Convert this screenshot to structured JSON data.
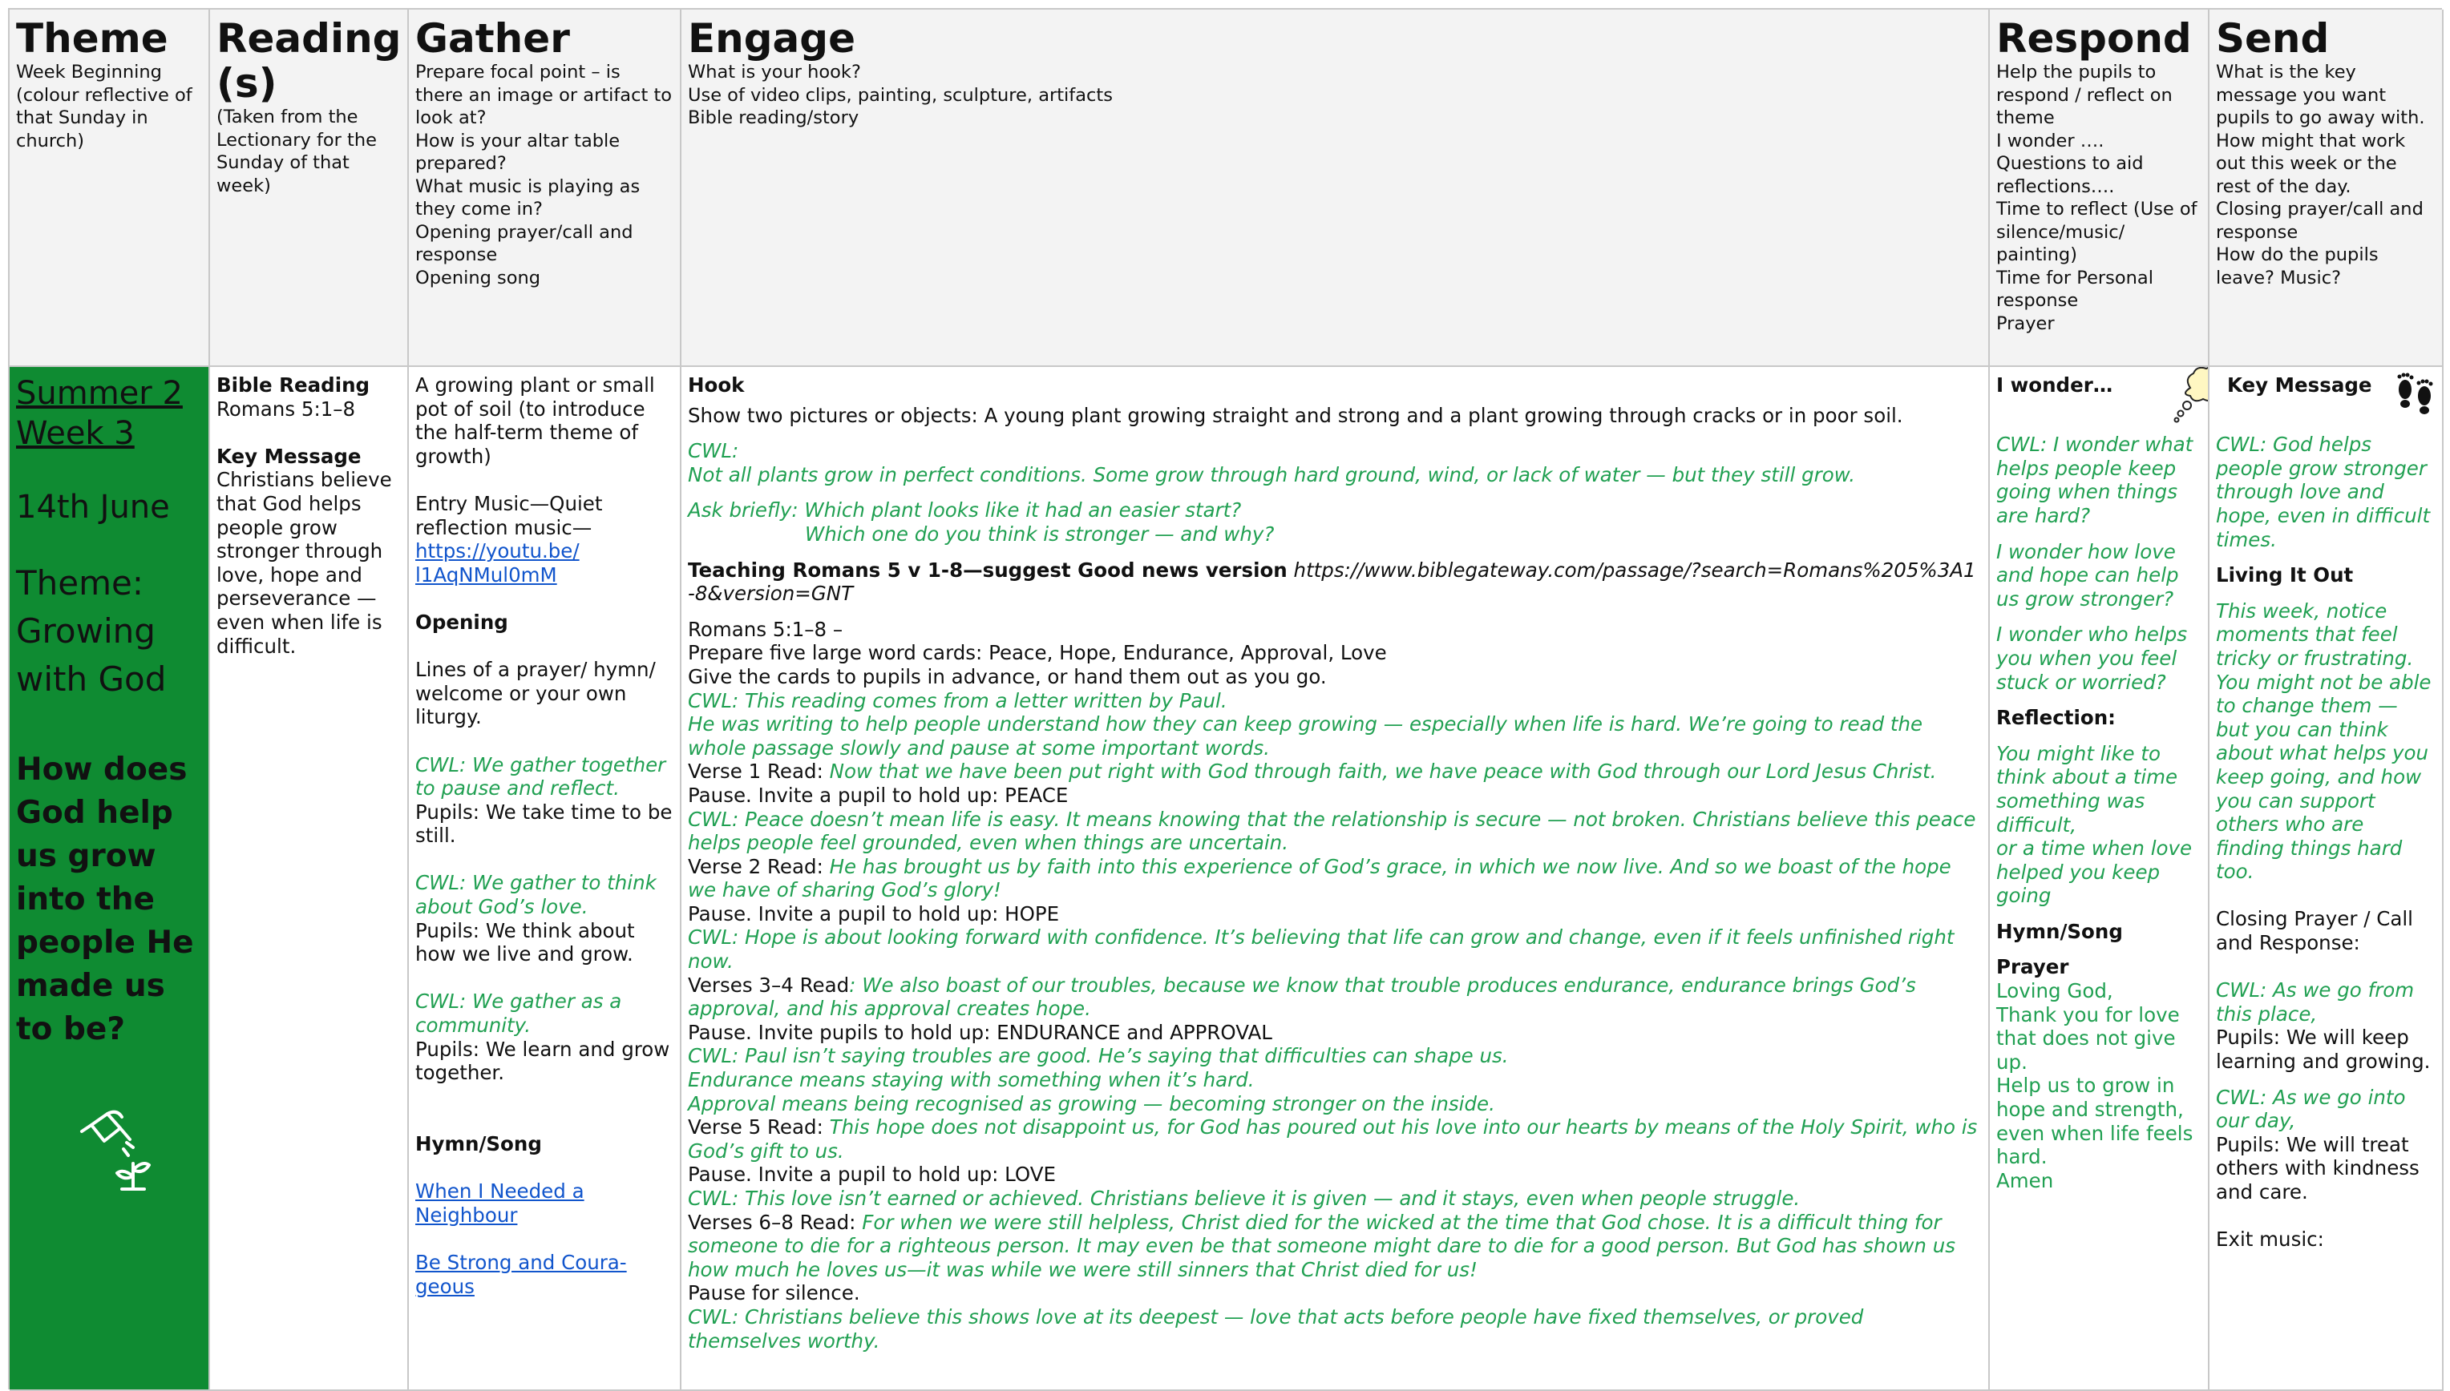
{
  "header": {
    "theme": {
      "title": "Theme",
      "desc": "Week Beginning (colour reflective of that Sunday in church)"
    },
    "reading": {
      "title": "Reading (s)",
      "desc": "(Taken from the Lectionary for the Sunday of that week)"
    },
    "gather": {
      "title": "Gather",
      "desc": "Prepare focal point – is there an image or artifact to look at?\nHow is your altar  table prepared?\nWhat music is playing as they come in?\nOpening prayer/call and response\nOpening song"
    },
    "engage": {
      "title": "Engage",
      "desc": "What is your hook?\nUse of video clips, painting, sculpture, artifacts\nBible reading/story"
    },
    "respond": {
      "title": "Respond",
      "desc": "Help the pupils to respond / reflect on theme\nI wonder ….\nQuestions to aid reflections….\nTime to reflect (Use of silence/music/ painting)\nTime for Personal response\nPrayer"
    },
    "send": {
      "title": "Send",
      "desc": "What is the key message you want pupils to go away with.\nHow might that work out this week or the rest of the day.\nClosing prayer/call and response\nHow do the pupils leave? Music?"
    }
  },
  "theme": {
    "week_line1": "Summer 2",
    "week_line2": "Week 3",
    "date": "14th June",
    "theme_label": "Theme: Growing with God",
    "question": "How does God help us grow into the people He made us to be?",
    "icon": "watering-can-plant-icon"
  },
  "reading": {
    "bible_heading": "Bible Reading",
    "bible_ref": "Romans 5:1–8",
    "key_heading": "Key Message",
    "key_text": "Christians believe that God helps people grow stronger through love, hope and perseverance — even when life is difficult."
  },
  "gather": {
    "intro": "A growing plant or small pot of soil (to introduce the half-term theme of growth)",
    "entry": "Entry Music—Quiet reflection music—",
    "entry_link": "https://youtu.be/ l1AqNMul0mM",
    "opening_heading": "Opening",
    "opening_text": "Lines of a prayer/ hymn/ welcome or your own liturgy.",
    "cwl1": "CWL: We gather together to pause and reflect.",
    "pupils1": "Pupils: We take time to be still.",
    "cwl2": "CWL: We gather to think about God’s love.",
    "pupils2": "Pupils: We think about how we live and grow.",
    "cwl3": "CWL: We gather as a community.",
    "pupils3": "Pupils: We learn and grow together.",
    "hymn_heading": "Hymn/Song",
    "hymn1": "When I Needed a Neighbour",
    "hymn2": "Be Strong and Coura-geous"
  },
  "engage": {
    "hook_heading": "Hook",
    "hook_text": "Show two pictures or objects: A young plant growing straight and strong and a plant growing through cracks or in poor soil.",
    "cwl_label": "CWL:",
    "cwl_plants": "Not all plants grow in perfect conditions. Some grow through hard ground, wind, or lack of water — but they still grow.",
    "ask1": "Ask briefly: Which plant looks like it had an easier start?",
    "ask2": "Which one do you think is stronger — and why?",
    "teaching_bold": "Teaching Romans 5 v 1-8—suggest Good news version",
    "teaching_url": "https://www.biblegateway.com/passage/?search=Romans%205%3A1-8&version=GNT",
    "romans_ref": "Romans 5:1–8 –",
    "cards_line1": "Prepare five large word cards: Peace, Hope, Endurance, Approval, Love",
    "cards_line2": "Give the cards to pupils in advance, or hand them out as you go.",
    "cwl_letter": "CWL: This reading comes from a letter written by Paul.",
    "cwl_writing": "He was writing to help people understand how they can keep growing — especially when life is hard. We’re going to read the whole passage slowly and pause at some important words.",
    "v1_label": "Verse 1 Read:",
    "v1_text": "Now that we have been put right with God through faith, we have peace with God through our Lord Jesus Christ.",
    "pause_peace": "Pause. Invite a pupil to hold up: PEACE",
    "cwl_peace": "CWL: Peace doesn’t mean life is easy. It means knowing that the relationship is secure — not broken. Christians believe this peace helps people feel grounded, even when things are uncertain.",
    "v2_label": "Verse 2 Read:",
    "v2_text": "He has brought us by faith into this experience of God’s grace, in which we now live. And so we boast of the hope we have of sharing God’s glory!",
    "pause_hope": "Pause. Invite a pupil to hold up: HOPE",
    "cwl_hope": "CWL: Hope is about looking forward with confidence. It’s believing that life can grow and change, even if it feels unfinished right now.",
    "v34_label": "Verses 3–4 Read",
    "v34_text": ": We also boast of our troubles, because we know that trouble produces endurance, endurance brings God’s approval, and his approval creates hope.",
    "pause_endurance": "Pause. Invite pupils to hold up: ENDURANCE and APPROVAL",
    "cwl_troubles": "CWL: Paul isn’t saying troubles are good. He’s saying that difficulties can shape us.",
    "endurance_means": "Endurance means staying with something when it’s hard.",
    "approval_means": "Approval means being recognised as growing — becoming stronger on the inside.",
    "v5_label": "Verse 5 Read:",
    "v5_text": "This hope does not disappoint us, for God has poured out his love into our hearts by means of the Holy Spirit, who is God’s gift to us.",
    "pause_love": "Pause. Invite a pupil to hold up: LOVE",
    "cwl_love": "CWL: This love isn’t earned or achieved. Christians believe it is given — and it stays, even when people struggle.",
    "v68_label": "Verses 6–8 Read:",
    "v68_text": "For when we were still helpless, Christ died for the wicked at the time that God chose. It is a difficult thing for someone to die for a righteous person. It may even be that someone might dare to die for a good person. But God has shown us how much he loves us—it was while we were still sinners that Christ died for us!",
    "pause_silence": "Pause for silence.",
    "cwl_deepest": "CWL: Christians believe this shows love at its deepest — love that acts before people have fixed themselves, or proved themselves worthy."
  },
  "respond": {
    "wonder_heading": "I wonder…",
    "thought_icon": "thought-bubble-icon",
    "w1": "CWL: I wonder what helps people keep going when things are hard?",
    "w2": "I wonder how love and hope can help us grow stronger?",
    "w3": "I wonder who helps you when you feel stuck or worried?",
    "reflection_heading": "Reflection:",
    "reflection_text": "You might like to think about a time something was difficult,\nor a time when love helped you keep going",
    "hymn_heading": "Hymn/Song",
    "prayer_heading": "Prayer",
    "prayer_text": "Loving God,\nThank you for love that does not give up.\nHelp us to grow in hope and strength, even when life feels hard.\nAmen"
  },
  "send": {
    "footprints_icon": "footprints-icon",
    "key_heading": "Key Message",
    "key_text": "CWL: God helps people grow stronger through love and hope, even in difficult times.",
    "living_heading": "Living It Out",
    "living_text": "This week, notice moments that feel tricky or frustrating. You might not be able to change them — but you can think about what helps you keep going, and how you can support others who are finding things hard too.",
    "closing": "Closing Prayer / Call and Response:",
    "cwl1": "CWL: As we go from this place,",
    "pupils1": "Pupils: We will keep learning and growing.",
    "cwl2": "CWL: As we go into our day,",
    "pupils2": "Pupils: We will treat others with kindness and care.",
    "exit": "Exit music:"
  },
  "colors": {
    "theme_green": "#0f8b32",
    "cwl_green": "#21a052",
    "link_blue": "#1155cc",
    "header_grey": "#f3f3f3"
  }
}
